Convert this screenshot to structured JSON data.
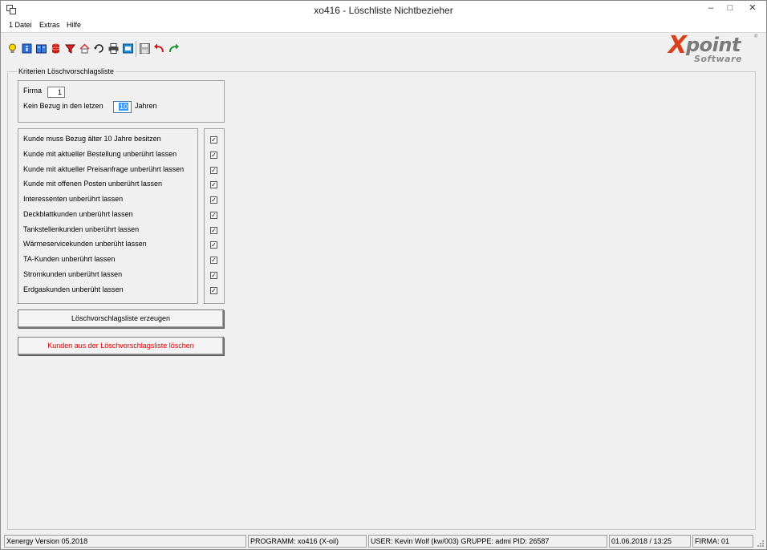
{
  "window": {
    "title": "xo416 - Löschliste Nichtbezieher",
    "controls": {
      "minimize": "‒",
      "maximize": "□",
      "close": "✕"
    }
  },
  "menu": [
    "1 Datei",
    "Extras",
    "Hilfe"
  ],
  "toolbar": {
    "buttons": [
      "info-bulb-icon",
      "info-icon",
      "book-icon",
      "database-icon",
      "filter-icon",
      "home-icon",
      "refresh-icon",
      "print-icon",
      "screen-icon",
      "save-icon",
      "undo-icon",
      "redo-icon"
    ]
  },
  "logo": {
    "x": "X",
    "point": "point",
    "software": "Software",
    "registered": "®"
  },
  "criteria": {
    "group_title": "Kriterien Löschvorschlagsliste",
    "firma_label": "Firma",
    "firma_value": "1",
    "bezug_label": "Kein Bezug in den letzen",
    "bezug_value": "10",
    "bezug_suffix": "Jahren",
    "options": [
      {
        "label": "Kunde muss Bezug älter 10 Jahre besitzen",
        "checked": true
      },
      {
        "label": "Kunde mit aktueller Bestellung unberührt lassen",
        "checked": true
      },
      {
        "label": "Kunde mit aktueller Preisanfrage unberührt lassen",
        "checked": true
      },
      {
        "label": "Kunde mit offenen Posten unberührt lassen",
        "checked": true
      },
      {
        "label": "Interessenten unberührt lassen",
        "checked": true
      },
      {
        "label": "Deckblattkunden unberührt lassen",
        "checked": true
      },
      {
        "label": "Tankstellenkunden unberührt lassen",
        "checked": true
      },
      {
        "label": "Wärmeservicekunden unberüht lassen",
        "checked": true
      },
      {
        "label": "TA-Kunden unberührt lassen",
        "checked": true
      },
      {
        "label": "Stromkunden unberührt lassen",
        "checked": true
      },
      {
        "label": "Erdgaskunden unberüht lassen",
        "checked": true
      }
    ],
    "check_mark": "✓",
    "create_button": "Löschvorschlagsliste erzeugen",
    "delete_button": "Kunden aus der Löschvorschlagsliste löschen",
    "delete_color": "#e00000"
  },
  "status": {
    "version": "Xenergy Version 05.2018",
    "program": "PROGRAMM: xo416 (X-oil)",
    "user": "USER: Kevin Wolf (kw/003)  GRUPPE: admi  PID: 26587",
    "datetime": "01.06.2018 / 13:25",
    "firma": "FIRMA: 01"
  }
}
